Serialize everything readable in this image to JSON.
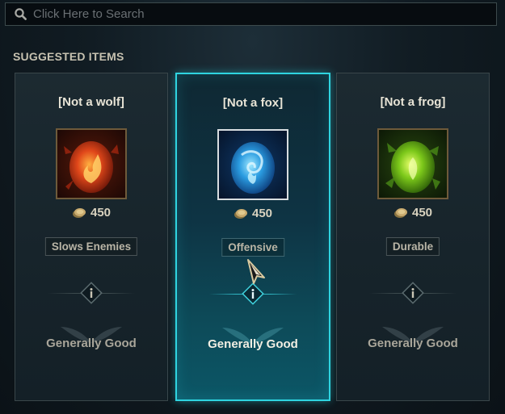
{
  "search": {
    "placeholder": "Click Here to Search",
    "icon": "search-icon"
  },
  "section_title": "SUGGESTED ITEMS",
  "items": [
    {
      "name": "[Not a wolf]",
      "price": "450",
      "tag": "Slows Enemies",
      "rating": "Generally Good",
      "selected": false,
      "color": "#d8401a"
    },
    {
      "name": "[Not a fox]",
      "price": "450",
      "tag": "Offensive",
      "rating": "Generally Good",
      "selected": true,
      "color": "#2a9be0"
    },
    {
      "name": "[Not a frog]",
      "price": "450",
      "tag": "Durable",
      "rating": "Generally Good",
      "selected": false,
      "color": "#7cc81a"
    }
  ],
  "colors": {
    "accent": "#2fd4e0",
    "gold": "#c8aa6e"
  }
}
